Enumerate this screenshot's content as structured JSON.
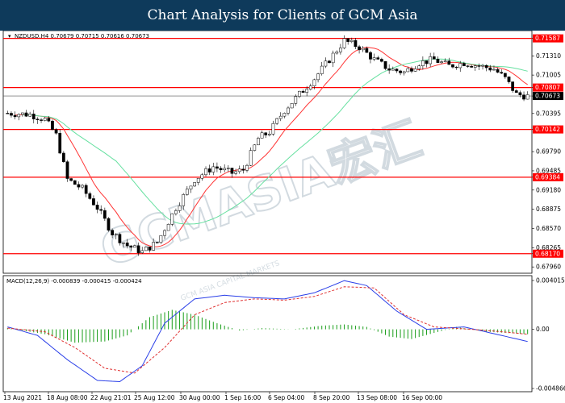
{
  "header": {
    "title": "Chart Analysis for Clients of GCM Asia",
    "bg": "#0e3a5b"
  },
  "watermark": {
    "text": "GCMASIA宏汇",
    "sub": "GCM ASIA CAPITAL MARKETS"
  },
  "chart_data": {
    "type": "candlestick",
    "symbol_info": "NZDUSD,H4  0.70679 0.70715 0.70616 0.70673",
    "price_axis": {
      "min": 0.6786,
      "max": 0.7171,
      "ticks": [
        0.71587,
        0.7131,
        0.71005,
        0.70807,
        0.70673,
        0.70395,
        0.70142,
        0.6979,
        0.69485,
        0.69384,
        0.6918,
        0.68875,
        0.6857,
        0.68265,
        0.6817,
        0.6796
      ],
      "labels": [
        "0.71587",
        "0.71310",
        "0.71005",
        "0.70807",
        "0.70673",
        "0.70395",
        "0.70142",
        "0.69790",
        "0.69485",
        "0.69384",
        "0.69180",
        "0.68875",
        "0.68570",
        "0.68265",
        "0.68170",
        "0.67960"
      ]
    },
    "x_labels": [
      "13 Aug 2021",
      "18 Aug 08:00",
      "22 Aug 21:01",
      "25 Aug 12:00",
      "30 Aug 00:00",
      "1 Sep 16:00",
      "6 Sep 04:00",
      "8 Sep 20:00",
      "13 Sep 08:00",
      "16 Sep 00:00"
    ],
    "horizontal_levels": [
      0.71587,
      0.70807,
      0.70142,
      0.69384,
      0.6817
    ],
    "current_price": 0.70673,
    "level_color": "#ff0000",
    "candle_up_color": "#ffffff",
    "candle_down_color": "#000000",
    "ma_fast_color": "#ff3333",
    "ma_slow_color": "#66e0a0",
    "close_anchors": [
      [
        0,
        0.704
      ],
      [
        6,
        0.7038
      ],
      [
        10,
        0.703
      ],
      [
        13,
        0.7005
      ],
      [
        16,
        0.6935
      ],
      [
        20,
        0.692
      ],
      [
        24,
        0.689
      ],
      [
        28,
        0.685
      ],
      [
        32,
        0.683
      ],
      [
        36,
        0.682
      ],
      [
        40,
        0.6835
      ],
      [
        45,
        0.689
      ],
      [
        50,
        0.6935
      ],
      [
        55,
        0.6955
      ],
      [
        60,
        0.6945
      ],
      [
        63,
        0.695
      ],
      [
        67,
        0.7
      ],
      [
        70,
        0.701
      ],
      [
        74,
        0.7045
      ],
      [
        78,
        0.707
      ],
      [
        82,
        0.7095
      ],
      [
        86,
        0.7125
      ],
      [
        90,
        0.7155
      ],
      [
        94,
        0.7145
      ],
      [
        98,
        0.7125
      ],
      [
        102,
        0.711
      ],
      [
        106,
        0.7105
      ],
      [
        110,
        0.712
      ],
      [
        114,
        0.7125
      ],
      [
        118,
        0.7115
      ],
      [
        122,
        0.712
      ],
      [
        126,
        0.7115
      ],
      [
        130,
        0.711
      ],
      [
        133,
        0.7095
      ],
      [
        136,
        0.707
      ],
      [
        139,
        0.7067
      ]
    ],
    "macd": {
      "label": "MACD(12,26,9) -0.000839 -0.000415 -0.000424",
      "min": -0.004866,
      "max": 0.004015,
      "ticks": [
        0.004015,
        0.0,
        -0.004866
      ],
      "tick_labels": [
        "0.004015",
        "0.00",
        "-0.004866"
      ],
      "main_color": "#2a3fe8",
      "signal_color": "#e03030",
      "hist_color": "#1a9e1a",
      "main_anchors": [
        [
          0,
          0.0002
        ],
        [
          8,
          -0.0005
        ],
        [
          16,
          -0.0025
        ],
        [
          24,
          -0.0042
        ],
        [
          30,
          -0.0043
        ],
        [
          36,
          -0.003
        ],
        [
          42,
          0.0005
        ],
        [
          50,
          0.0025
        ],
        [
          58,
          0.0028
        ],
        [
          66,
          0.0026
        ],
        [
          74,
          0.0025
        ],
        [
          82,
          0.003
        ],
        [
          90,
          0.004
        ],
        [
          96,
          0.0036
        ],
        [
          104,
          0.0015
        ],
        [
          112,
          0.0
        ],
        [
          122,
          0.0002
        ],
        [
          132,
          -0.0005
        ],
        [
          139,
          -0.001
        ]
      ],
      "signal_anchors": [
        [
          0,
          0.0001
        ],
        [
          10,
          -0.0002
        ],
        [
          18,
          -0.0015
        ],
        [
          26,
          -0.0032
        ],
        [
          34,
          -0.0036
        ],
        [
          42,
          -0.0015
        ],
        [
          50,
          0.0012
        ],
        [
          58,
          0.0022
        ],
        [
          66,
          0.0025
        ],
        [
          74,
          0.0024
        ],
        [
          82,
          0.0027
        ],
        [
          90,
          0.0035
        ],
        [
          98,
          0.0034
        ],
        [
          106,
          0.0012
        ],
        [
          114,
          0.0002
        ],
        [
          124,
          0.0
        ],
        [
          132,
          -0.0002
        ],
        [
          139,
          -0.0004
        ]
      ],
      "hist_anchors": [
        [
          0,
          0.0001
        ],
        [
          10,
          -0.0004
        ],
        [
          18,
          -0.0011
        ],
        [
          26,
          -0.001
        ],
        [
          32,
          -0.0005
        ],
        [
          38,
          0.001
        ],
        [
          44,
          0.0016
        ],
        [
          50,
          0.0012
        ],
        [
          56,
          0.0005
        ],
        [
          62,
          -0.0001
        ],
        [
          68,
          0.0001
        ],
        [
          76,
          0.0
        ],
        [
          84,
          0.0003
        ],
        [
          90,
          0.0004
        ],
        [
          96,
          0.0002
        ],
        [
          102,
          -0.0006
        ],
        [
          108,
          -0.0008
        ],
        [
          114,
          -0.0003
        ],
        [
          120,
          0.0002
        ],
        [
          128,
          -0.0002
        ],
        [
          139,
          -0.0004
        ]
      ]
    }
  }
}
